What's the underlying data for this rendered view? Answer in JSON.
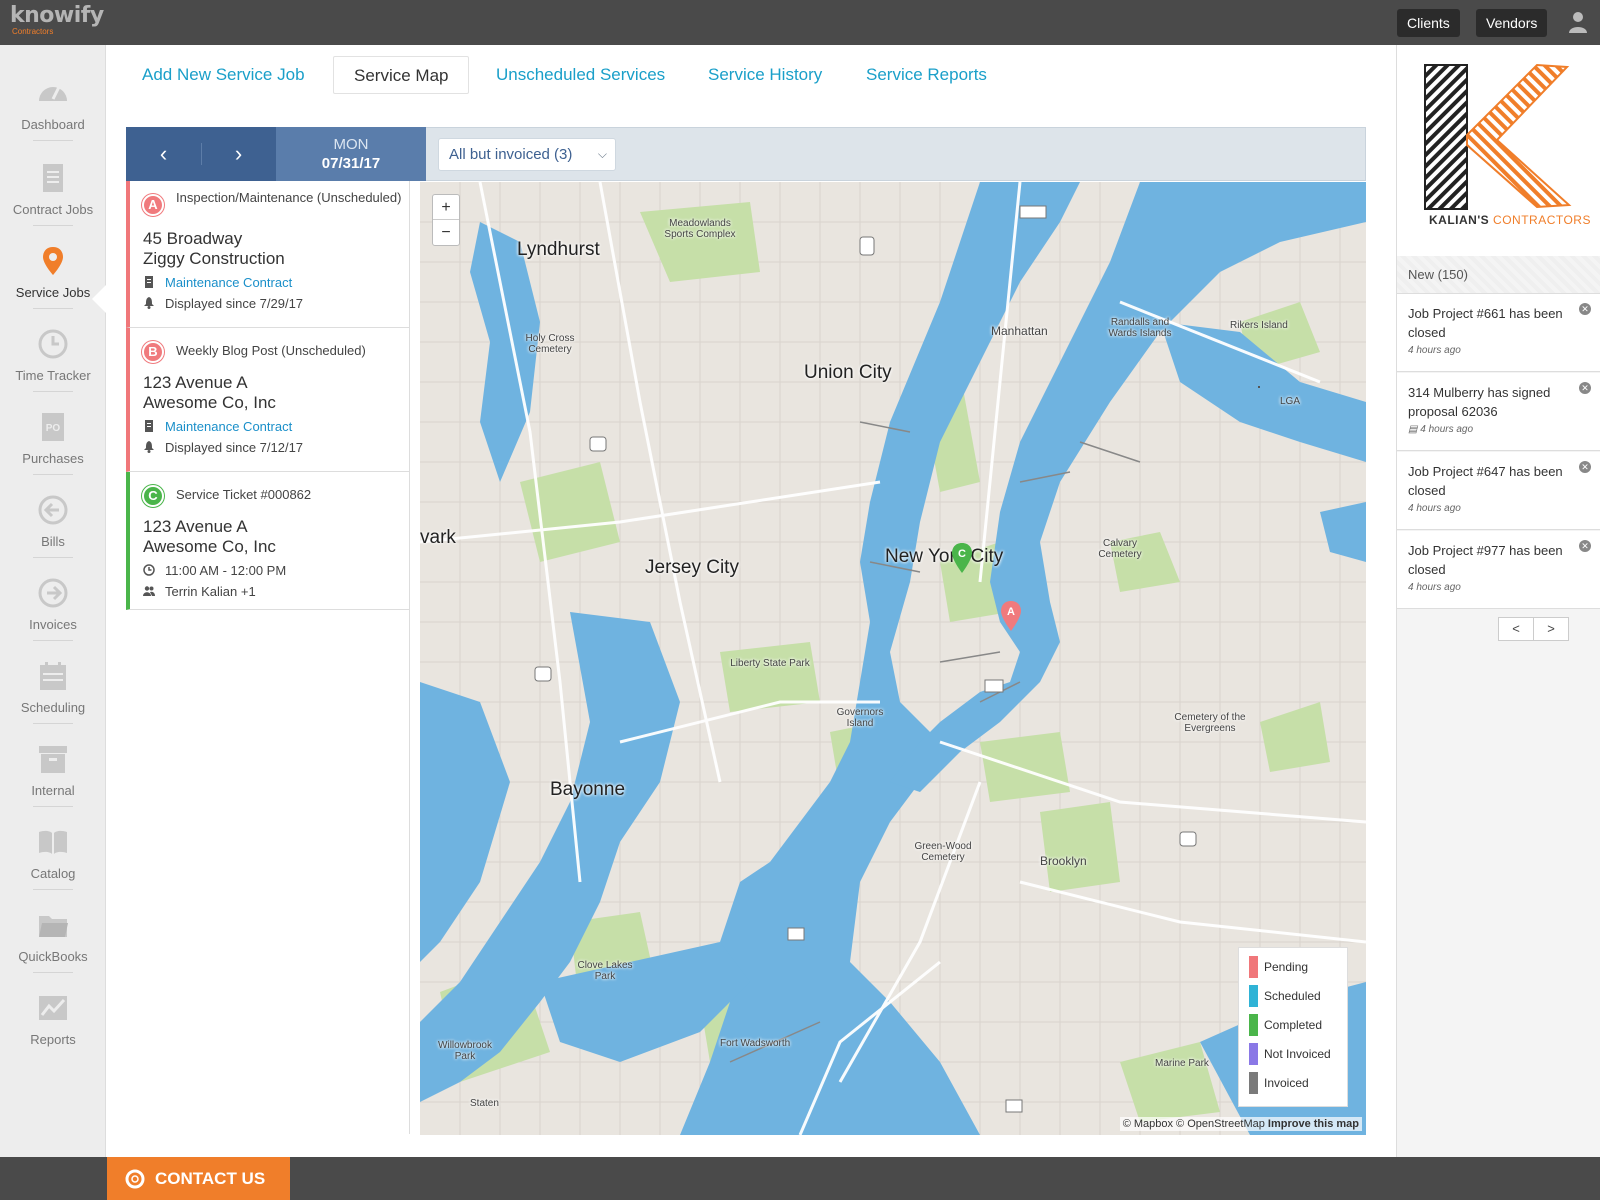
{
  "app": {
    "logo": "knowify",
    "logo_sub": "Contractors"
  },
  "topbar": {
    "clients_label": "Clients",
    "vendors_label": "Vendors"
  },
  "leftnav": {
    "items": [
      {
        "label": "Dashboard",
        "icon": "gauge-icon"
      },
      {
        "label": "Contract Jobs",
        "icon": "document-icon"
      },
      {
        "label": "Service Jobs",
        "icon": "map-pin-icon"
      },
      {
        "label": "Time Tracker",
        "icon": "clock-icon"
      },
      {
        "label": "Purchases",
        "icon": "po-icon"
      },
      {
        "label": "Bills",
        "icon": "arrow-left-circle-icon"
      },
      {
        "label": "Invoices",
        "icon": "arrow-right-circle-icon"
      },
      {
        "label": "Scheduling",
        "icon": "calendar-icon"
      },
      {
        "label": "Internal",
        "icon": "archive-icon"
      },
      {
        "label": "Catalog",
        "icon": "book-icon"
      },
      {
        "label": "QuickBooks",
        "icon": "folder-icon"
      },
      {
        "label": "Reports",
        "icon": "chart-icon"
      }
    ],
    "active": "Service Jobs"
  },
  "tabs": [
    {
      "label": "Add New Service Job"
    },
    {
      "label": "Service Map"
    },
    {
      "label": "Unscheduled Services"
    },
    {
      "label": "Service History"
    },
    {
      "label": "Service Reports"
    }
  ],
  "toolbar": {
    "prev": "‹",
    "next": "›",
    "day": "MON",
    "date": "07/31/17",
    "filter": "All but invoiced (3)"
  },
  "jobs": [
    {
      "marker": "A",
      "type": "Inspection/Maintenance (Unscheduled)",
      "address": "45 Broadway",
      "client": "Ziggy Construction",
      "contract": "Maintenance Contract",
      "since": "Displayed since 7/29/17"
    },
    {
      "marker": "B",
      "type": "Weekly Blog Post (Unscheduled)",
      "address": "123 Avenue A",
      "client": "Awesome Co, Inc",
      "contract": "Maintenance Contract",
      "since": "Displayed since 7/12/17"
    },
    {
      "marker": "C",
      "type": "Service Ticket #000862",
      "address": "123 Avenue A",
      "client": "Awesome Co, Inc",
      "time": "11:00 AM - 12:00 PM",
      "crew": "Terrin Kalian +1"
    }
  ],
  "map": {
    "zoom_in": "+",
    "zoom_out": "−",
    "labels": {
      "lyndhurst": "Lyndhurst",
      "union_city": "Union City",
      "jersey_city": "Jersey City",
      "new_york_city": "New York City",
      "bayonne": "Bayonne",
      "newark": "vark",
      "manhattan": "Manhattan",
      "brooklyn": "Brooklyn",
      "meadowlands": "Meadowlands Sports Complex",
      "liberty_state_park": "Liberty State Park",
      "governors_island": "Governors Island",
      "calvary_cemetery": "Calvary Cemetery",
      "green_wood": "Green-Wood Cemetery",
      "clove_lakes": "Clove Lakes Park",
      "fort_wadsworth": "Fort Wadsworth",
      "rikers": "Rikers Island",
      "randalls": "Randalls and Wards Islands",
      "holy_cross": "Holy Cross Cemetery",
      "evergreens": "Cemetery of the Evergreens",
      "marine_park": "Marine Park",
      "willowbrook": "Willowbrook Park",
      "staten": "Staten",
      "lga": "LGA"
    },
    "legend": [
      {
        "label": "Pending",
        "color": "#f0777a"
      },
      {
        "label": "Scheduled",
        "color": "#2fb3d6"
      },
      {
        "label": "Completed",
        "color": "#4ab54a"
      },
      {
        "label": "Not Invoiced",
        "color": "#8a78e6"
      },
      {
        "label": "Invoiced",
        "color": "#7a7a7a"
      }
    ],
    "attribution_1": "© Mapbox © OpenStreetMap",
    "attribution_2": "Improve this map"
  },
  "rightpanel": {
    "brand_name": "KALIAN'S",
    "brand_suffix": "CONTRACTORS",
    "notif_header": "New (150)",
    "notifications": [
      {
        "title": "Job Project #661 has been closed",
        "time": "4 hours ago"
      },
      {
        "title": "314 Mulberry has signed proposal 62036",
        "time": "4 hours ago"
      },
      {
        "title": "Job Project #647 has been closed",
        "time": "4 hours ago"
      },
      {
        "title": "Job Project #977 has been closed",
        "time": "4 hours ago"
      }
    ],
    "pager_prev": "<",
    "pager_next": ">"
  },
  "footer": {
    "contact_label": "CONTACT US"
  },
  "colors": {
    "accent": "#1a9fc9",
    "brand_orange": "#f07e2a",
    "nav_blue": "#3e6191",
    "water": "#6fb3e0",
    "park": "#c6dfa8"
  }
}
